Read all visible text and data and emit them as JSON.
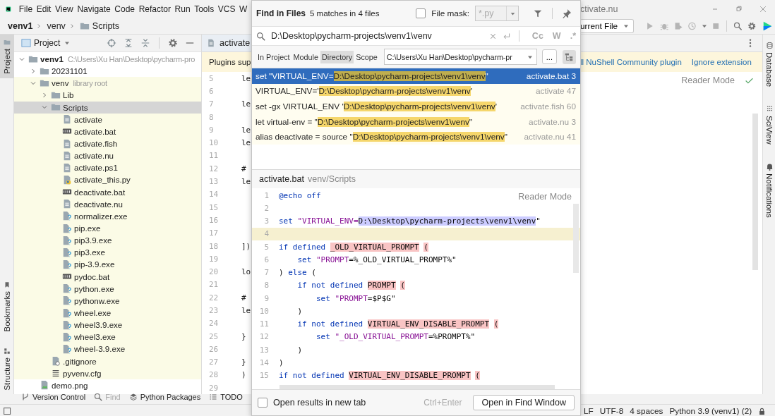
{
  "menu": [
    "File",
    "Edit",
    "View",
    "Navigate",
    "Code",
    "Refactor",
    "Run",
    "Tools",
    "VCS",
    "W"
  ],
  "title": "ctivate.nu",
  "breadcrumb": [
    "venv1",
    "venv",
    "Scripts"
  ],
  "run_config": "urrent File",
  "left_stripe": {
    "top": [
      {
        "label": "Project",
        "selected": true
      }
    ],
    "bottom": [
      {
        "label": "Bookmarks",
        "selected": false
      },
      {
        "label": "Structure",
        "selected": false
      }
    ]
  },
  "right_stripe": [
    {
      "label": "Database"
    },
    {
      "label": "SciView"
    },
    {
      "label": "Notifications"
    }
  ],
  "project_panel": {
    "title": "Project",
    "tree": [
      {
        "name": "venv1",
        "kind": "root",
        "expanded": true,
        "selected": false,
        "hint": "C:\\Users\\Xu Han\\Desktop\\pycharm-pro",
        "children": [
          {
            "name": "20231101",
            "kind": "folder",
            "expanded": false,
            "selected": false
          },
          {
            "name": "venv",
            "kind": "library",
            "expanded": true,
            "selected": false,
            "hint": "library root",
            "children": [
              {
                "name": "Lib",
                "kind": "folder",
                "expanded": false,
                "selected": false
              },
              {
                "name": "Scripts",
                "kind": "folder",
                "expanded": true,
                "selected": true,
                "children": [
                  {
                    "name": "activate",
                    "kind": "text",
                    "selected": false
                  },
                  {
                    "name": "activate.bat",
                    "kind": "bat",
                    "selected": false
                  },
                  {
                    "name": "activate.fish",
                    "kind": "text",
                    "selected": false
                  },
                  {
                    "name": "activate.nu",
                    "kind": "text",
                    "selected": false
                  },
                  {
                    "name": "activate.ps1",
                    "kind": "text",
                    "selected": false
                  },
                  {
                    "name": "activate_this.py",
                    "kind": "py",
                    "selected": false
                  },
                  {
                    "name": "deactivate.bat",
                    "kind": "bat",
                    "selected": false
                  },
                  {
                    "name": "deactivate.nu",
                    "kind": "text",
                    "selected": false
                  },
                  {
                    "name": "normalizer.exe",
                    "kind": "exe",
                    "selected": false
                  },
                  {
                    "name": "pip.exe",
                    "kind": "exe",
                    "selected": false
                  },
                  {
                    "name": "pip3.9.exe",
                    "kind": "exe",
                    "selected": false
                  },
                  {
                    "name": "pip3.exe",
                    "kind": "exe",
                    "selected": false
                  },
                  {
                    "name": "pip-3.9.exe",
                    "kind": "exe",
                    "selected": false
                  },
                  {
                    "name": "pydoc.bat",
                    "kind": "bat",
                    "selected": false
                  },
                  {
                    "name": "python.exe",
                    "kind": "exe",
                    "selected": false
                  },
                  {
                    "name": "pythonw.exe",
                    "kind": "exe",
                    "selected": false
                  },
                  {
                    "name": "wheel.exe",
                    "kind": "exe",
                    "selected": false
                  },
                  {
                    "name": "wheel3.9.exe",
                    "kind": "exe",
                    "selected": false
                  },
                  {
                    "name": "wheel3.exe",
                    "kind": "exe",
                    "selected": false
                  },
                  {
                    "name": "wheel-3.9.exe",
                    "kind": "exe",
                    "selected": false
                  }
                ]
              },
              {
                "name": ".gitignore",
                "kind": "ignore",
                "selected": false
              },
              {
                "name": "pyvenv.cfg",
                "kind": "cfg",
                "selected": false
              }
            ]
          },
          {
            "name": "demo.png",
            "kind": "image",
            "selected": false
          }
        ]
      }
    ]
  },
  "editor": {
    "tab": "activate",
    "notice": "Plugins sup",
    "notice_actions": [
      "ll NuShell Community plugin",
      "Ignore extension"
    ],
    "reader_mode": "Reader Mode",
    "lines": [
      {
        "number": "5",
        "code": "le"
      },
      {
        "number": "6"
      },
      {
        "number": "7",
        "code": "le"
      },
      {
        "number": "8"
      },
      {
        "number": "9",
        "code": "le"
      },
      {
        "number": "10",
        "code": "le"
      },
      {
        "number": "11"
      },
      {
        "number": "12",
        "code": "#"
      },
      {
        "number": "13",
        "code": "le"
      },
      {
        "number": "14"
      },
      {
        "number": "15"
      },
      {
        "number": "16"
      },
      {
        "number": "17"
      },
      {
        "number": "18",
        "code": "])"
      },
      {
        "number": "19"
      },
      {
        "number": "20",
        "code": "lo"
      },
      {
        "number": "21"
      },
      {
        "number": "22",
        "code": "#"
      },
      {
        "number": "23",
        "code": "le"
      },
      {
        "number": "24"
      },
      {
        "number": "25",
        "code": "}"
      },
      {
        "number": "26"
      },
      {
        "number": "27",
        "code": "}"
      },
      {
        "number": "28",
        "code": ")"
      },
      {
        "number": "29"
      }
    ]
  },
  "find": {
    "title": "Find in Files",
    "summary": "5 matches in 4 files",
    "file_mask": {
      "label": "File mask:",
      "checked": false,
      "value": "*.py"
    },
    "query": "D:\\Desktop\\pycharm-projects\\venv1\\venv",
    "options": [
      "Cc",
      "W",
      ".*"
    ],
    "scopes": [
      {
        "label": "In Project",
        "selected": false
      },
      {
        "label": "Module",
        "selected": false
      },
      {
        "label": "Directory",
        "selected": true
      },
      {
        "label": "Scope",
        "selected": false
      }
    ],
    "directory": "C:\\Users\\Xu Han\\Desktop\\pycharm-pr",
    "browse": "...",
    "recursive": true,
    "results": [
      {
        "before": "set \"VIRTUAL_ENV=",
        "match": "D:\\Desktop\\pycharm-projects\\venv1\\venv",
        "after": "\"",
        "file": "activate.bat 3",
        "selected": true
      },
      {
        "before": "VIRTUAL_ENV='",
        "match": "D:\\Desktop\\pycharm-projects\\venv1\\venv",
        "after": "'",
        "file": "activate 47",
        "selected": false
      },
      {
        "before": "set -gx VIRTUAL_ENV '",
        "match": "D:\\Desktop\\pycharm-projects\\venv1\\venv",
        "after": "'",
        "file": "activate.fish 60",
        "selected": false
      },
      {
        "before": "let virtual-env = \"",
        "match": "D:\\Desktop\\pycharm-projects\\venv1\\venv",
        "after": "\"",
        "file": "activate.nu 3",
        "selected": false
      },
      {
        "before": "alias deactivate = source \"",
        "match": "D:\\Desktop\\pycharm-projects\\venv1\\venv",
        "after": "\"",
        "file": "activate.nu 41",
        "selected": false
      }
    ],
    "preview": {
      "file": "activate.bat",
      "path": "venv/Scripts",
      "reader_mode": "Reader Mode",
      "lines": [
        {
          "number": "1",
          "current": false,
          "tokens": [
            {
              "kind": "keyword",
              "text": "@echo off"
            }
          ]
        },
        {
          "number": "2",
          "current": false
        },
        {
          "number": "3",
          "current": false,
          "tokens": [
            {
              "kind": "keyword",
              "text": "set "
            },
            {
              "kind": "string",
              "text": "\"VIRTUAL_ENV="
            },
            {
              "kind": "match",
              "text": "D:\\Desktop\\pycharm-projects\\venv1\\venv"
            },
            {
              "kind": "plain",
              "text": "\""
            }
          ]
        },
        {
          "number": "4",
          "current": true
        },
        {
          "number": "5",
          "current": false,
          "tokens": [
            {
              "kind": "keyword",
              "text": "if defined "
            },
            {
              "kind": "variable",
              "text": "_OLD_VIRTUAL_PROMPT"
            },
            {
              "kind": "variable",
              "text": "("
            }
          ]
        },
        {
          "number": "6",
          "current": false,
          "tokens": [
            {
              "kind": "keyword",
              "text": "    set "
            },
            {
              "kind": "string",
              "text": "\"PROMPT"
            },
            {
              "kind": "plain",
              "text": "=%_OLD_VIRTUAL_PROMPT%\""
            }
          ]
        },
        {
          "number": "7",
          "current": false,
          "tokens": [
            {
              "kind": "plain",
              "text": ") "
            },
            {
              "kind": "keyword",
              "text": "else"
            },
            {
              "kind": "plain",
              "text": " ("
            }
          ]
        },
        {
          "number": "8",
          "current": false,
          "tokens": [
            {
              "kind": "keyword",
              "text": "    if not defined "
            },
            {
              "kind": "variable",
              "text": "PROMPT"
            },
            {
              "kind": "variable",
              "text": "("
            }
          ]
        },
        {
          "number": "9",
          "current": false,
          "tokens": [
            {
              "kind": "keyword",
              "text": "        set "
            },
            {
              "kind": "string",
              "text": "\"PROMPT"
            },
            {
              "kind": "plain",
              "text": "=$P$G\""
            }
          ]
        },
        {
          "number": "10",
          "current": false,
          "tokens": [
            {
              "kind": "plain",
              "text": "    )"
            }
          ]
        },
        {
          "number": "11",
          "current": false,
          "tokens": [
            {
              "kind": "keyword",
              "text": "    if not defined "
            },
            {
              "kind": "variable",
              "text": "VIRTUAL_ENV_DISABLE_PROMPT"
            },
            {
              "kind": "variable",
              "text": "("
            }
          ]
        },
        {
          "number": "12",
          "current": false,
          "tokens": [
            {
              "kind": "keyword",
              "text": "        set "
            },
            {
              "kind": "string",
              "text": "\"_OLD_VIRTUAL_PROMPT"
            },
            {
              "kind": "plain",
              "text": "=%PROMPT%\""
            }
          ]
        },
        {
          "number": "13",
          "current": false,
          "tokens": [
            {
              "kind": "plain",
              "text": "    )"
            }
          ]
        },
        {
          "number": "14",
          "current": false,
          "tokens": [
            {
              "kind": "plain",
              "text": ")"
            }
          ]
        },
        {
          "number": "15",
          "current": false,
          "tokens": [
            {
              "kind": "keyword",
              "text": "if not defined "
            },
            {
              "kind": "variable",
              "text": "VIRTUAL_ENV_DISABLE_PROMPT"
            },
            {
              "kind": "variable",
              "text": "("
            }
          ]
        }
      ]
    },
    "new_tab": {
      "label": "Open results in new tab",
      "checked": false
    },
    "shortcut": "Ctrl+Enter",
    "open_button": "Open in Find Window"
  },
  "tool_windows": [
    {
      "label": "Version Control",
      "disabled": false
    },
    {
      "label": "Find",
      "disabled": true
    },
    {
      "label": "Python Packages",
      "disabled": false
    },
    {
      "label": "TODO",
      "disabled": false
    }
  ],
  "status_bar": [
    "LF",
    "UTF-8",
    "4 spaces",
    "Python 3.9 (venv1) (2)"
  ]
}
